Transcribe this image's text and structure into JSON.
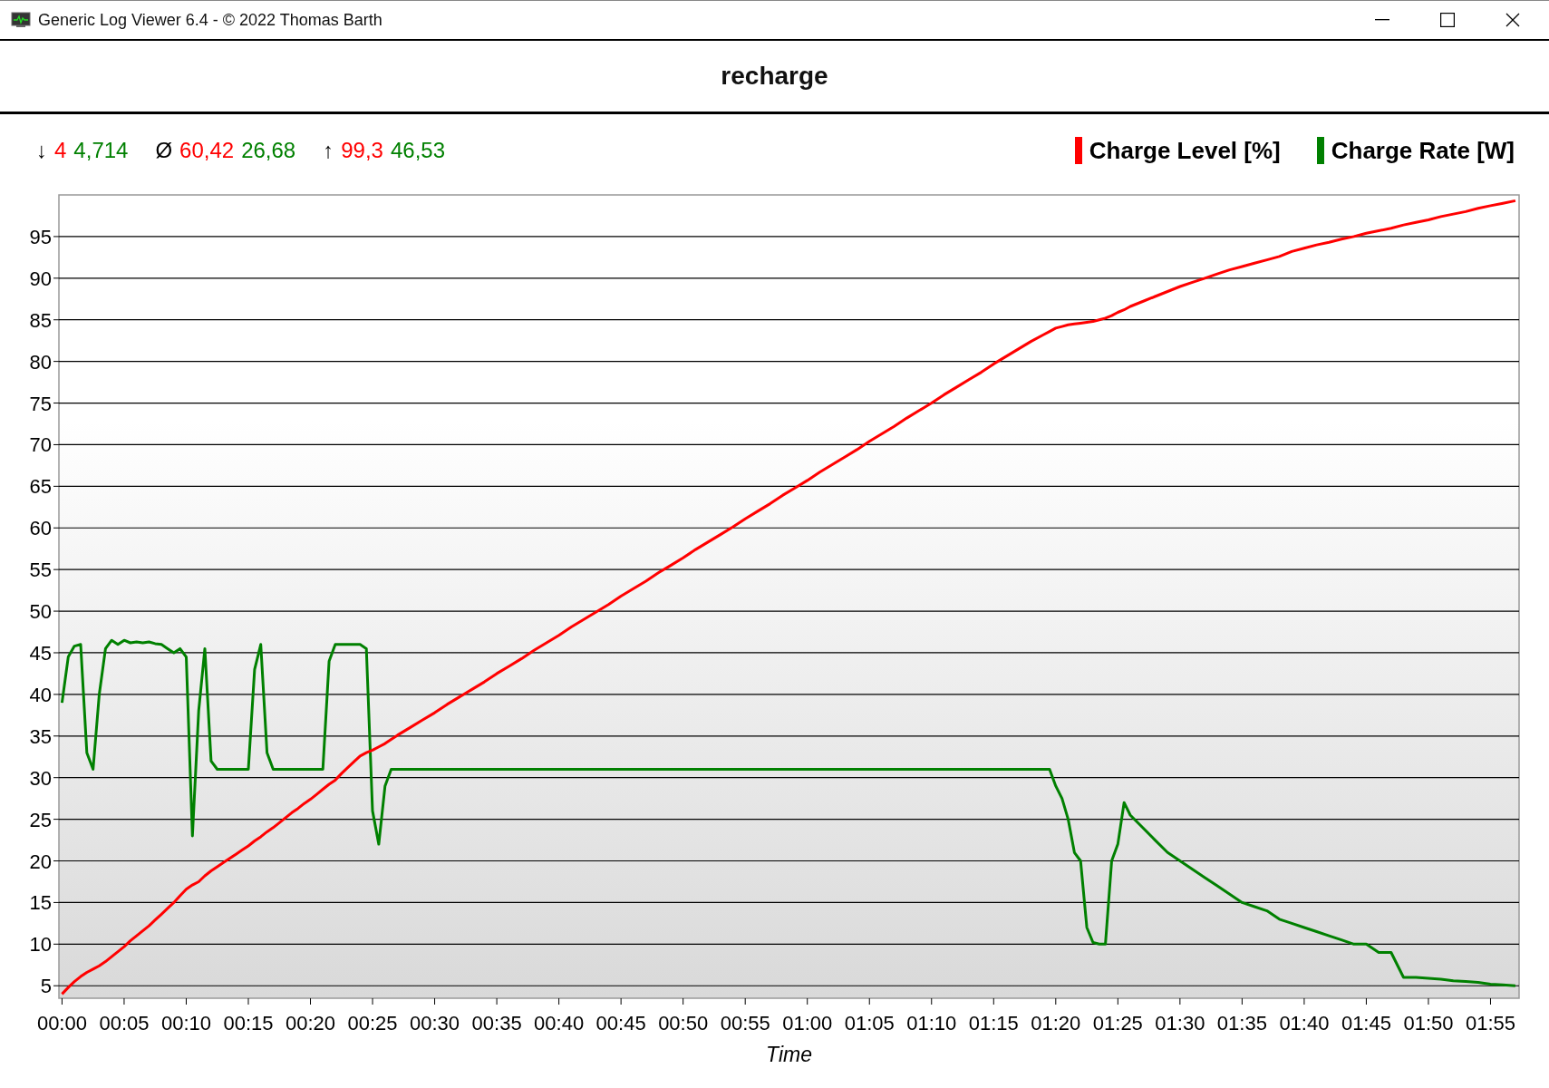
{
  "window": {
    "title": "Generic Log Viewer 6.4 - © 2022 Thomas Barth"
  },
  "chart": {
    "title": "recharge",
    "stats": [
      {
        "symbol": "↓",
        "values": [
          {
            "text": "4",
            "color": "#ff0000"
          },
          {
            "text": "4,714",
            "color": "#008000"
          }
        ]
      },
      {
        "symbol": "Ø",
        "values": [
          {
            "text": "60,42",
            "color": "#ff0000"
          },
          {
            "text": "26,68",
            "color": "#008000"
          }
        ]
      },
      {
        "symbol": "↑",
        "values": [
          {
            "text": "99,3",
            "color": "#ff0000"
          },
          {
            "text": "46,53",
            "color": "#008000"
          }
        ]
      }
    ],
    "chart_data": {
      "type": "line",
      "grid": true,
      "xlabel": "Time",
      "xlim": [
        -0.25,
        117.3
      ],
      "ylim": [
        3.5,
        100
      ],
      "x": [
        0,
        0.5,
        1,
        1.5,
        2,
        2.5,
        3,
        3.5,
        4,
        4.5,
        5,
        5.5,
        6,
        6.5,
        7,
        7.5,
        8,
        8.5,
        9,
        9.5,
        10,
        10.5,
        11,
        11.5,
        12,
        12.5,
        13,
        13.5,
        14,
        14.5,
        15,
        15.5,
        16,
        16.5,
        17,
        17.5,
        18,
        18.5,
        19,
        19.5,
        20,
        20.5,
        21,
        21.5,
        22,
        22.5,
        23,
        23.5,
        24,
        24.5,
        25,
        25.5,
        26,
        26.5,
        27,
        28,
        29,
        30,
        31,
        32,
        33,
        34,
        35,
        36,
        37,
        38,
        39,
        40,
        41,
        42,
        43,
        44,
        45,
        46,
        47,
        48,
        49,
        50,
        51,
        52,
        53,
        54,
        55,
        56,
        57,
        58,
        59,
        60,
        61,
        62,
        63,
        64,
        65,
        66,
        67,
        68,
        69,
        70,
        71,
        72,
        73,
        74,
        75,
        76,
        77,
        78,
        79,
        79.5,
        80,
        80.5,
        81,
        81.5,
        82,
        82.5,
        83,
        83.5,
        84,
        84.5,
        85,
        85.5,
        86,
        87,
        88,
        89,
        90,
        91,
        92,
        93,
        94,
        95,
        96,
        97,
        98,
        99,
        100,
        101,
        102,
        103,
        104,
        105,
        106,
        107,
        108,
        109,
        110,
        111,
        112,
        113,
        114,
        115,
        116,
        117
      ],
      "series": [
        {
          "name": "Charge Level [%]",
          "color": "#ff0000",
          "values": [
            4,
            4.8,
            5.5,
            6.1,
            6.6,
            7,
            7.4,
            7.9,
            8.5,
            9.1,
            9.7,
            10.4,
            11,
            11.6,
            12.2,
            12.9,
            13.6,
            14.3,
            15,
            15.8,
            16.6,
            17.1,
            17.5,
            18.2,
            18.8,
            19.3,
            19.8,
            20.3,
            20.8,
            21.3,
            21.8,
            22.4,
            22.9,
            23.5,
            24,
            24.6,
            25.2,
            25.8,
            26.3,
            26.9,
            27.4,
            28,
            28.6,
            29.2,
            29.7,
            30.5,
            31.2,
            31.9,
            32.6,
            33,
            33.3,
            33.7,
            34.1,
            34.6,
            35.1,
            36,
            36.9,
            37.8,
            38.8,
            39.7,
            40.6,
            41.5,
            42.5,
            43.4,
            44.3,
            45.3,
            46.2,
            47.1,
            48.1,
            49,
            49.9,
            50.8,
            51.8,
            52.7,
            53.6,
            54.6,
            55.5,
            56.4,
            57.4,
            58.3,
            59.2,
            60.1,
            61.1,
            62,
            62.9,
            63.9,
            64.8,
            65.7,
            66.7,
            67.6,
            68.5,
            69.4,
            70.4,
            71.3,
            72.2,
            73.2,
            74.1,
            75,
            76,
            76.9,
            77.8,
            78.7,
            79.7,
            80.6,
            81.5,
            82.4,
            83.2,
            83.6,
            84,
            84.2,
            84.4,
            84.5,
            84.6,
            84.7,
            84.8,
            85,
            85.2,
            85.5,
            85.9,
            86.2,
            86.6,
            87.2,
            87.8,
            88.4,
            89,
            89.5,
            90,
            90.5,
            91,
            91.4,
            91.8,
            92.2,
            92.6,
            93.2,
            93.6,
            94,
            94.3,
            94.7,
            95,
            95.4,
            95.7,
            96,
            96.4,
            96.7,
            97,
            97.4,
            97.7,
            98,
            98.4,
            98.7,
            99,
            99.3
          ]
        },
        {
          "name": "Charge Rate [W]",
          "color": "#008000",
          "values": [
            39,
            44.5,
            45.8,
            46,
            33,
            31,
            40,
            45.5,
            46.5,
            46,
            46.5,
            46.2,
            46.3,
            46.2,
            46.3,
            46.1,
            46,
            45.5,
            45,
            45.5,
            44.5,
            23,
            38,
            45.5,
            32,
            31,
            31,
            31,
            31,
            31,
            31,
            43,
            46,
            33,
            31,
            31,
            31,
            31,
            31,
            31,
            31,
            31,
            31,
            44,
            46,
            46,
            46,
            46,
            46,
            45.5,
            26,
            22,
            29,
            31,
            31,
            31,
            31,
            31,
            31,
            31,
            31,
            31,
            31,
            31,
            31,
            31,
            31,
            31,
            31,
            31,
            31,
            31,
            31,
            31,
            31,
            31,
            31,
            31,
            31,
            31,
            31,
            31,
            31,
            31,
            31,
            31,
            31,
            31,
            31,
            31,
            31,
            31,
            31,
            31,
            31,
            31,
            31,
            31,
            31,
            31,
            31,
            31,
            31,
            31,
            31,
            31,
            31,
            31,
            29,
            27.5,
            25,
            21,
            20,
            12,
            10.2,
            10,
            10,
            20,
            22,
            27,
            25.5,
            24,
            22.5,
            21,
            20,
            19,
            18,
            17,
            16,
            15,
            14.5,
            14,
            13,
            12.5,
            12,
            11.5,
            11,
            10.5,
            10,
            10,
            9,
            9,
            6,
            6,
            5.9,
            5.8,
            5.6,
            5.5,
            5.4,
            5.2,
            5.1,
            5
          ]
        }
      ],
      "xticks": [
        {
          "value": 0,
          "label": "00:00"
        },
        {
          "value": 5,
          "label": "00:05"
        },
        {
          "value": 10,
          "label": "00:10"
        },
        {
          "value": 15,
          "label": "00:15"
        },
        {
          "value": 20,
          "label": "00:20"
        },
        {
          "value": 25,
          "label": "00:25"
        },
        {
          "value": 30,
          "label": "00:30"
        },
        {
          "value": 35,
          "label": "00:35"
        },
        {
          "value": 40,
          "label": "00:40"
        },
        {
          "value": 45,
          "label": "00:45"
        },
        {
          "value": 50,
          "label": "00:50"
        },
        {
          "value": 55,
          "label": "00:55"
        },
        {
          "value": 60,
          "label": "01:00"
        },
        {
          "value": 65,
          "label": "01:05"
        },
        {
          "value": 70,
          "label": "01:10"
        },
        {
          "value": 75,
          "label": "01:15"
        },
        {
          "value": 80,
          "label": "01:20"
        },
        {
          "value": 85,
          "label": "01:25"
        },
        {
          "value": 90,
          "label": "01:30"
        },
        {
          "value": 95,
          "label": "01:35"
        },
        {
          "value": 100,
          "label": "01:40"
        },
        {
          "value": 105,
          "label": "01:45"
        },
        {
          "value": 110,
          "label": "01:50"
        },
        {
          "value": 115,
          "label": "01:55"
        }
      ],
      "yticks": [
        5,
        10,
        15,
        20,
        25,
        30,
        35,
        40,
        45,
        50,
        55,
        60,
        65,
        70,
        75,
        80,
        85,
        90,
        95
      ]
    }
  }
}
